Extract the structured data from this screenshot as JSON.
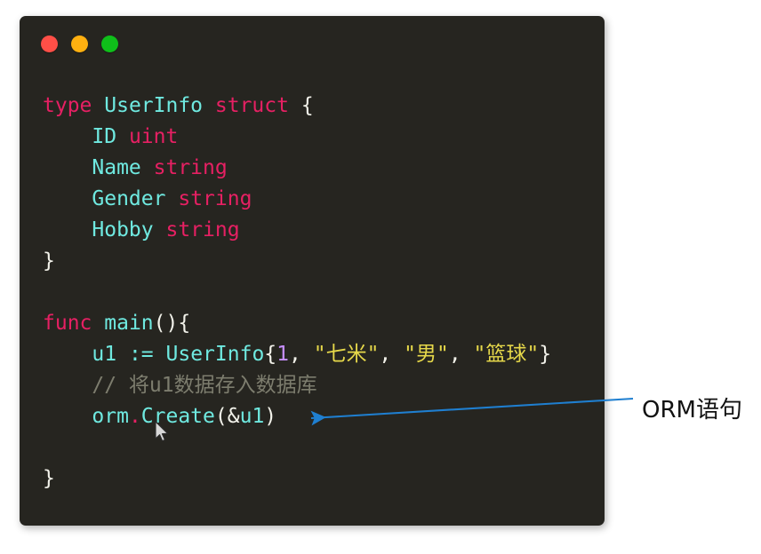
{
  "window": {
    "traffic_lights": [
      {
        "name": "close-button",
        "color": "#ff4f47"
      },
      {
        "name": "minimize-button",
        "color": "#ffb010"
      },
      {
        "name": "maximize-button",
        "color": "#0fbf1a"
      }
    ]
  },
  "code": {
    "language": "go",
    "lines": [
      {
        "tokens": [
          {
            "t": "type",
            "c": "kw"
          },
          {
            "t": " ",
            "c": "punc"
          },
          {
            "t": "UserInfo",
            "c": "ident"
          },
          {
            "t": " ",
            "c": "punc"
          },
          {
            "t": "struct",
            "c": "kw"
          },
          {
            "t": " {",
            "c": "punc"
          }
        ]
      },
      {
        "tokens": [
          {
            "t": "    ",
            "c": "punc"
          },
          {
            "t": "ID",
            "c": "ident"
          },
          {
            "t": " ",
            "c": "punc"
          },
          {
            "t": "uint",
            "c": "kw"
          }
        ]
      },
      {
        "tokens": [
          {
            "t": "    ",
            "c": "punc"
          },
          {
            "t": "Name",
            "c": "ident"
          },
          {
            "t": " ",
            "c": "punc"
          },
          {
            "t": "string",
            "c": "kw"
          }
        ]
      },
      {
        "tokens": [
          {
            "t": "    ",
            "c": "punc"
          },
          {
            "t": "Gender",
            "c": "ident"
          },
          {
            "t": " ",
            "c": "punc"
          },
          {
            "t": "string",
            "c": "kw"
          }
        ]
      },
      {
        "tokens": [
          {
            "t": "    ",
            "c": "punc"
          },
          {
            "t": "Hobby",
            "c": "ident"
          },
          {
            "t": " ",
            "c": "punc"
          },
          {
            "t": "string",
            "c": "kw"
          }
        ]
      },
      {
        "tokens": [
          {
            "t": "}",
            "c": "punc"
          }
        ]
      },
      {
        "tokens": []
      },
      {
        "tokens": [
          {
            "t": "func",
            "c": "kw"
          },
          {
            "t": " ",
            "c": "punc"
          },
          {
            "t": "main",
            "c": "ident"
          },
          {
            "t": "(){",
            "c": "punc"
          }
        ]
      },
      {
        "tokens": [
          {
            "t": "    ",
            "c": "punc"
          },
          {
            "t": "u1",
            "c": "ident"
          },
          {
            "t": " ",
            "c": "punc"
          },
          {
            "t": ":=",
            "c": "ident"
          },
          {
            "t": " ",
            "c": "punc"
          },
          {
            "t": "UserInfo",
            "c": "ident"
          },
          {
            "t": "{",
            "c": "punc"
          },
          {
            "t": "1",
            "c": "num"
          },
          {
            "t": ", ",
            "c": "punc"
          },
          {
            "t": "\"七米\"",
            "c": "str"
          },
          {
            "t": ", ",
            "c": "punc"
          },
          {
            "t": "\"男\"",
            "c": "str"
          },
          {
            "t": ", ",
            "c": "punc"
          },
          {
            "t": "\"篮球\"",
            "c": "str"
          },
          {
            "t": "}",
            "c": "punc"
          }
        ]
      },
      {
        "tokens": [
          {
            "t": "    ",
            "c": "punc"
          },
          {
            "t": "// 将u1数据存入数据库",
            "c": "cmt"
          }
        ]
      },
      {
        "tokens": [
          {
            "t": "    ",
            "c": "punc"
          },
          {
            "t": "orm",
            "c": "ident"
          },
          {
            "t": ".",
            "c": "dotop"
          },
          {
            "t": "Create",
            "c": "ident"
          },
          {
            "t": "(&",
            "c": "punc"
          },
          {
            "t": "u1",
            "c": "ident"
          },
          {
            "t": ")",
            "c": "punc"
          }
        ]
      },
      {
        "tokens": []
      },
      {
        "tokens": [
          {
            "t": "}",
            "c": "punc"
          }
        ]
      }
    ]
  },
  "annotation": {
    "label": "ORM语句",
    "arrow_color": "#1f7fd0",
    "target": "orm.Create(&u1)"
  }
}
